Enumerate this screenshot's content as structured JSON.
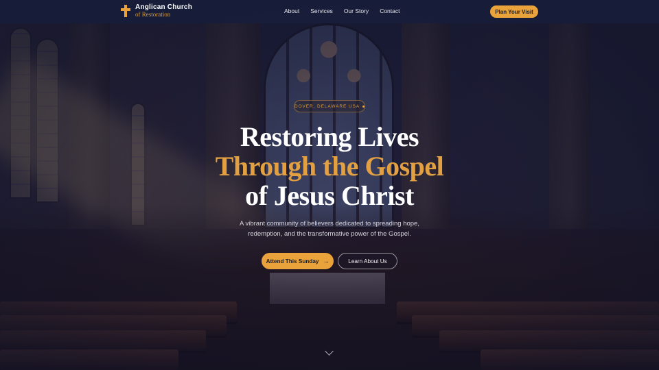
{
  "brand": {
    "name": "Anglican Church",
    "subtitle": "of Restoration",
    "icon": "cross-icon"
  },
  "nav": {
    "links": [
      "About",
      "Services",
      "Our Story",
      "Contact"
    ],
    "cta": "Plan Your Visit"
  },
  "hero": {
    "badge": "DOVER, DELAWARE USA",
    "headline": [
      "Restoring Lives",
      "Through the Gospel",
      "of Jesus Christ"
    ],
    "lead": "A vibrant community of believers dedicated to spreading hope, redemption, and the transformative power of the Gospel.",
    "primary_button": "Attend This Sunday",
    "secondary_button": "Learn About Us",
    "scroll_icon": "chevron-down-icon"
  },
  "colors": {
    "accent": "#e9a33a",
    "nav_bg": "#181e3a",
    "text": "#ffffff"
  }
}
